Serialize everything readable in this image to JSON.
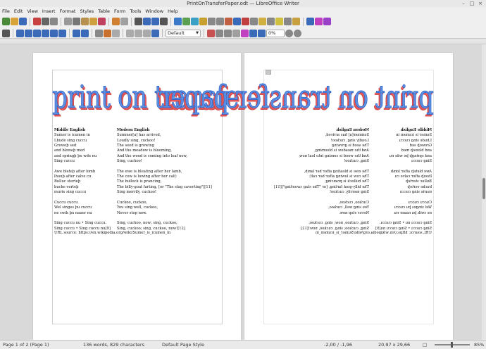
{
  "window": {
    "title": "PrintOnTransferPaper.odt — LibreOffice Writer"
  },
  "menubar": [
    "File",
    "Edit",
    "View",
    "Insert",
    "Format",
    "Styles",
    "Table",
    "Form",
    "Tools",
    "Window",
    "Help"
  ],
  "toolbar": {
    "style_name": "Default",
    "zoom_field": "0%"
  },
  "document": {
    "fontwork_text": "print on transfer paper",
    "left_header": "Middle English",
    "right_header": "Modern English",
    "left_lines": [
      "Sumer is icumen in",
      "Lhude sing cuccu",
      "Groweþ sed",
      "and bloweþ med",
      "and springþ þe wde nu",
      "Sing cuccu",
      "",
      "Awe bleteþ after lomb",
      "lhouþ after calve cu",
      "Bulluc sterteþ",
      "bucke verteþ",
      "murie sing cuccu",
      "",
      "Cuccu cuccu",
      "Wel singes þu cuccu",
      "ne swik þu nauer nu",
      "",
      "Sing cuccu nu • Sing cuccu.",
      "Sing cuccu • Sing cuccu nu[9]"
    ],
    "right_lines": [
      "Summer[a] has arrived,",
      "Loudly sing, cuckoo!",
      "The seed is growing",
      "And the meadow is blooming,",
      "And the wood is coming into leaf now,",
      "Sing, cuckoo!",
      "",
      "The ewe is bleating after her lamb,",
      "The cow is lowing after her calf;",
      "The bullock is prancing,",
      "The billy-goat farting, [or \"The stag cavorting\"][11]",
      "Sing merrily, cuckoo!",
      "",
      "Cuckoo, cuckoo,",
      "You sing well, cuckoo,",
      "Never stop now.",
      "",
      "Sing, cuckoo, now; sing, cuckoo;",
      "Sing, cuckoo; sing, cuckoo, now![12]"
    ],
    "url_line": "URL source: https://en.wikipedia.org/wiki/Sumer_is_icumen_in"
  },
  "statusbar": {
    "page_info": "Page 1 of 2 (Page 1)",
    "word_count": "136 words, 829 characters",
    "page_style": "Default Page Style",
    "cursor_pos": "-2,00 / -1,96",
    "object_size": "20,97 x 29,66",
    "zoom_percent": "85%"
  },
  "colors": {
    "fontwork_fill": "#5b8fe0",
    "fontwork_shadow": "#e85a5a",
    "accent": "#3355bb"
  }
}
